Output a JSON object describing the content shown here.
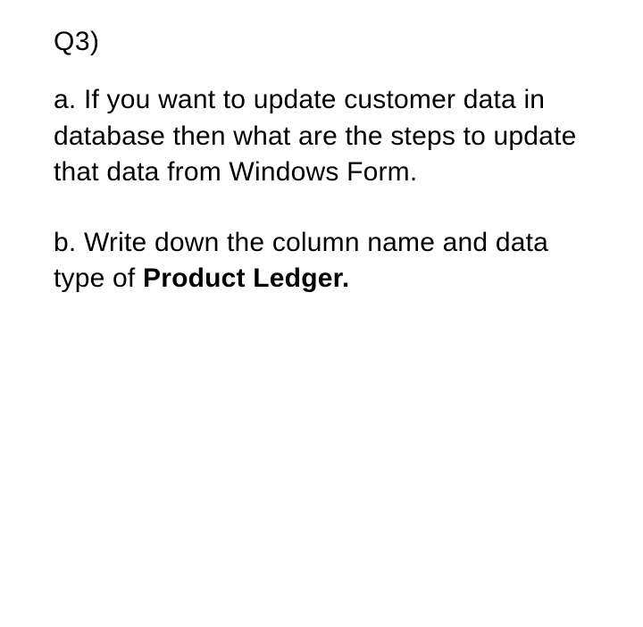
{
  "question": {
    "number": "Q3)",
    "parts": {
      "a": {
        "text": "a. If you want to update customer data in database then what are the steps to update that data from Windows Form."
      },
      "b": {
        "prefix": "b. Write down the column name and data type of ",
        "bold": "Product Ledger."
      }
    }
  }
}
